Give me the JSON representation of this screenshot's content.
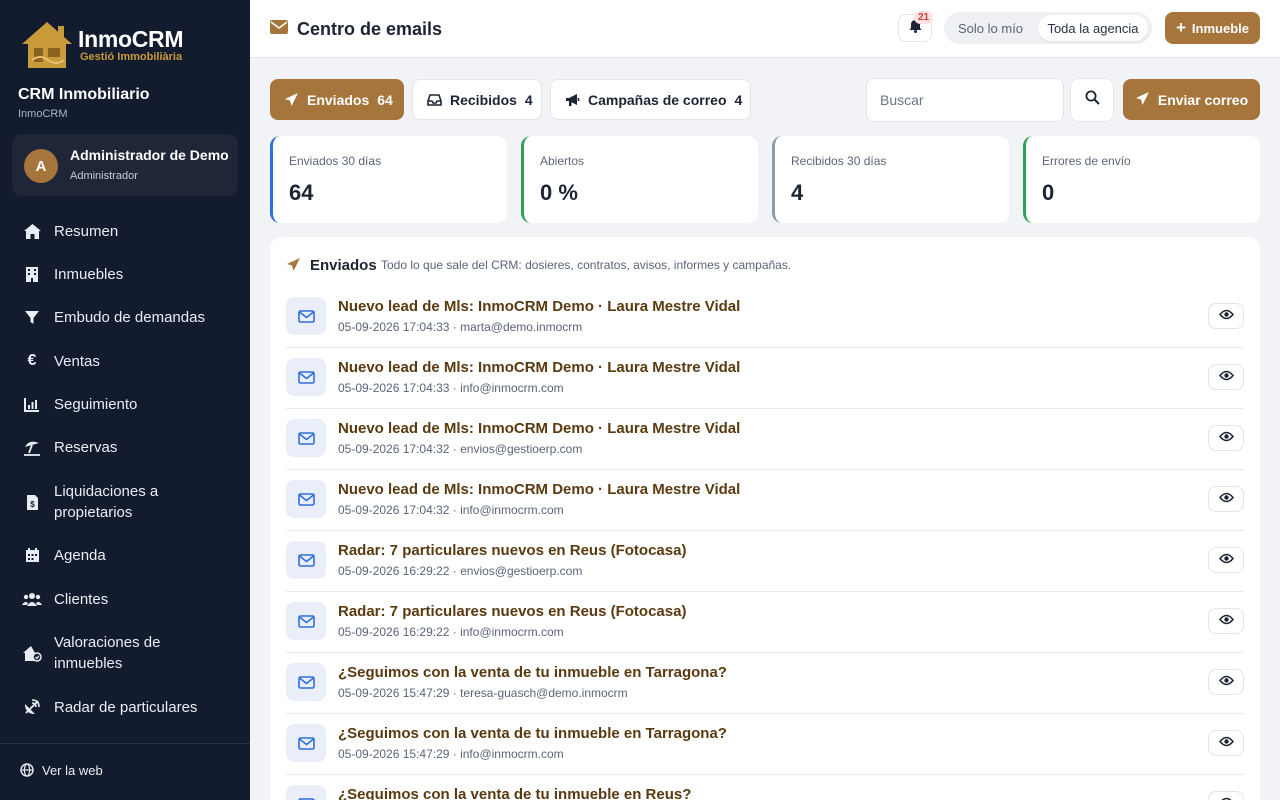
{
  "brand": {
    "name": "InmoCRM",
    "tagline": "Gestió Immobiliària",
    "accent": "#a5753c"
  },
  "sidebar": {
    "crm_title": "CRM Inmobiliario",
    "crm_sub": "InmoCRM",
    "user": {
      "initial": "A",
      "name": "Administrador de Demo",
      "role": "Administrador"
    },
    "items": [
      {
        "label": "Resumen",
        "icon": "home-icon"
      },
      {
        "label": "Inmuebles",
        "icon": "building-icon"
      },
      {
        "label": "Embudo de demandas",
        "icon": "funnel-icon"
      },
      {
        "label": "Ventas",
        "icon": "euro-icon"
      },
      {
        "label": "Seguimiento",
        "icon": "chart-icon"
      },
      {
        "label": "Reservas",
        "icon": "umbrella-icon"
      },
      {
        "label": "Liquidaciones a propietarios",
        "icon": "invoice-icon"
      },
      {
        "label": "Agenda",
        "icon": "calendar-icon"
      },
      {
        "label": "Clientes",
        "icon": "users-icon"
      },
      {
        "label": "Valoraciones de inmuebles",
        "icon": "house-value-icon"
      },
      {
        "label": "Radar de particulares",
        "icon": "satellite-icon"
      }
    ],
    "footer": {
      "label": "Ver la web",
      "icon": "globe-icon"
    }
  },
  "header": {
    "title": "Centro de emails",
    "notifications": "21",
    "scope_options": [
      "Solo lo mío",
      "Toda la agencia"
    ],
    "scope_selected": "Toda la agencia",
    "add_button": "Inmueble"
  },
  "tabs": [
    {
      "label": "Enviados",
      "count": "64",
      "active": true
    },
    {
      "label": "Recibidos",
      "count": "4",
      "active": false
    },
    {
      "label": "Campañas de correo",
      "count": "4",
      "active": false
    }
  ],
  "search": {
    "placeholder": "Buscar",
    "value": ""
  },
  "send_button": "Enviar correo",
  "stats": [
    {
      "label": "Enviados 30 días",
      "value": "64",
      "color": "#2f6fde"
    },
    {
      "label": "Abiertos",
      "value": "0 %",
      "color": "#2ea05a"
    },
    {
      "label": "Recibidos 30 días",
      "value": "4",
      "color": "#8e99ab"
    },
    {
      "label": "Errores de envío",
      "value": "0",
      "color": "#2ea05a"
    }
  ],
  "panel": {
    "title": "Enviados",
    "description": "Todo lo que sale del CRM: dosieres, contratos, avisos, informes y campañas.",
    "emails": [
      {
        "subject": "Nuevo lead de Mls: InmoCRM Demo · Laura Mestre Vidal",
        "meta": "05-09-2026 17:04:33 · marta@demo.inmocrm"
      },
      {
        "subject": "Nuevo lead de Mls: InmoCRM Demo · Laura Mestre Vidal",
        "meta": "05-09-2026 17:04:33 · info@inmocrm.com"
      },
      {
        "subject": "Nuevo lead de Mls: InmoCRM Demo · Laura Mestre Vidal",
        "meta": "05-09-2026 17:04:32 · envios@gestioerp.com"
      },
      {
        "subject": "Nuevo lead de Mls: InmoCRM Demo · Laura Mestre Vidal",
        "meta": "05-09-2026 17:04:32 · info@inmocrm.com"
      },
      {
        "subject": "Radar: 7 particulares nuevos en Reus (Fotocasa)",
        "meta": "05-09-2026 16:29:22 · envios@gestioerp.com"
      },
      {
        "subject": "Radar: 7 particulares nuevos en Reus (Fotocasa)",
        "meta": "05-09-2026 16:29:22 · info@inmocrm.com"
      },
      {
        "subject": "¿Seguimos con la venta de tu inmueble en Tarragona?",
        "meta": "05-09-2026 15:47:29 · teresa-guasch@demo.inmocrm"
      },
      {
        "subject": "¿Seguimos con la venta de tu inmueble en Tarragona?",
        "meta": "05-09-2026 15:47:29 · info@inmocrm.com"
      },
      {
        "subject": "¿Seguimos con la venta de tu inmueble en Reus?",
        "meta": ""
      }
    ]
  }
}
